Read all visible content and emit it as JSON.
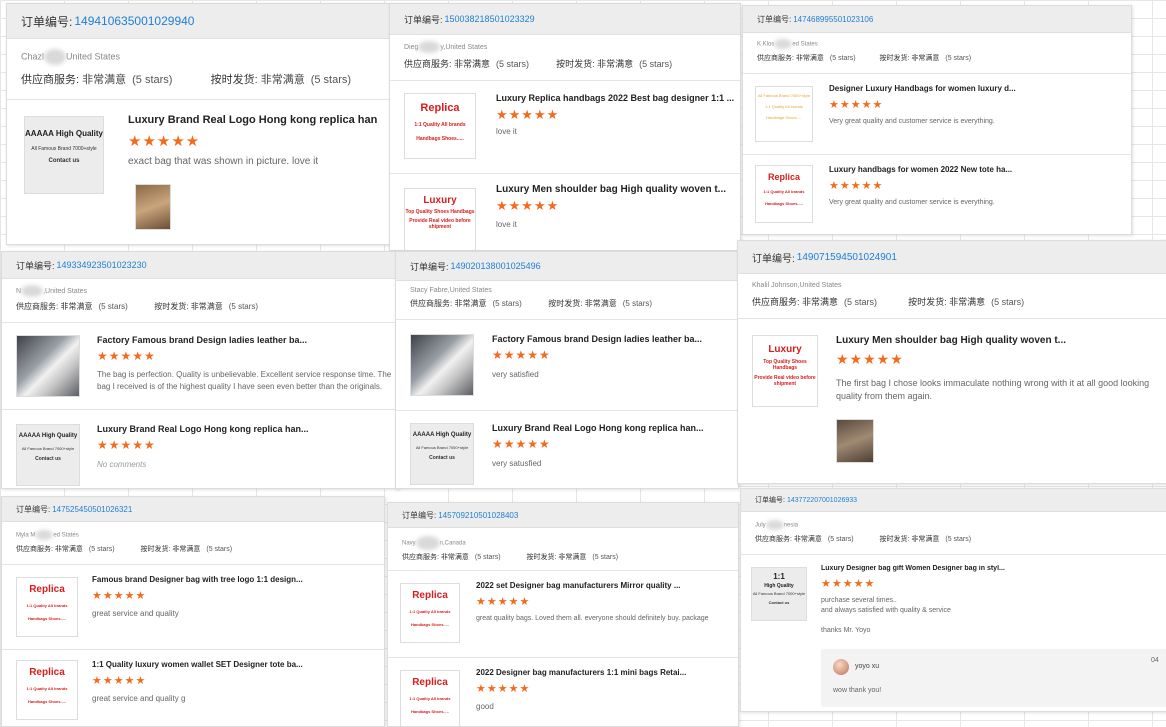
{
  "labels": {
    "order_no": "订单编号:",
    "supplier_service": "供应商服务:",
    "on_time": "按时发货:",
    "very_satisfied": "非常满意",
    "five_stars": "(5 stars)",
    "no_comments": "No comments"
  },
  "cards": [
    {
      "order": "149410635001029940",
      "customer_prefix": "Chazl",
      "customer_suffix": "United States",
      "items": [
        {
          "title": "Luxury Brand Real Logo Hong kong replica han",
          "comment": "exact bag that was shown in picture. love it"
        }
      ]
    },
    {
      "order": "150038218501023329",
      "customer_prefix": "Dieg",
      "customer_suffix": "y,United States",
      "items": [
        {
          "title": "Luxury Replica handbags 2022 Best bag designer 1:1 ...",
          "comment": "love it"
        },
        {
          "title": "Luxury Men shoulder bag High quality woven t...",
          "comment": "love it"
        }
      ]
    },
    {
      "order": "147468995501023106",
      "customer_prefix": "K Klos",
      "customer_suffix": "ed States",
      "items": [
        {
          "title": "Designer Luxury Handbags for women luxury d...",
          "comment": "Very great quality and customer service is everything."
        },
        {
          "title": "Luxury handbags for women 2022 New tote ha...",
          "comment": "Very great quality and customer service is everything."
        }
      ]
    },
    {
      "order": "149334923501023230",
      "customer_prefix": "N",
      "customer_suffix": ",United States",
      "items": [
        {
          "title": "Factory Famous brand Design ladies leather ba...",
          "comment": "The bag is perfection.  Quality is unbelievable.  Excellent service response time. The bag I received is of the highest quality I have seen even better than the originals."
        },
        {
          "title": "Luxury Brand Real Logo Hong kong replica han..."
        }
      ]
    },
    {
      "order": "149020138001025496",
      "customer_prefix": "Stacy Fabre",
      "customer_suffix": ",United States",
      "items": [
        {
          "title": "Factory Famous brand Design ladies leather ba...",
          "comment": "very satisfied"
        },
        {
          "title": "Luxury Brand Real Logo Hong kong replica han...",
          "comment": "very satusfied"
        }
      ]
    },
    {
      "order": "149071594501024901",
      "customer_prefix": "Khalil Johnson",
      "customer_suffix": ",United States",
      "items": [
        {
          "title": "Luxury Men shoulder bag High quality woven t...",
          "comment": "The first bag I chose looks immaculate nothing wrong with it at all good looking quality from them again."
        }
      ]
    },
    {
      "order": "147525450501026321",
      "customer_prefix": "Myla M",
      "customer_suffix": "ed States",
      "items": [
        {
          "title": "Famous brand Designer bag with tree logo 1:1 design...",
          "comment": "great service and quality"
        },
        {
          "title": "1:1 Quality luxury women wallet SET Designer tote ba...",
          "comment": "great service and quality g"
        }
      ]
    },
    {
      "order": "145709210501028403",
      "customer_prefix": "Navy",
      "customer_suffix": "n,Canada",
      "items": [
        {
          "title": "2022 set Designer bag manufacturers Mirror quality ...",
          "comment": "great quality bags. Loved them all. everyone should definitely buy. package"
        },
        {
          "title": "2022 Designer bag manufacturers 1:1 mini bags Retai...",
          "comment": "good"
        }
      ]
    },
    {
      "order": "143772207001026933",
      "customer_prefix": "July",
      "customer_suffix": "nesia",
      "items": [
        {
          "title": "Luxury Designer bag gift Women Designer bag in styl...",
          "comment_lines": [
            "purchase several times..",
            "and always satisfied with quality & service"
          ],
          "extra": "thanks Mr. Yoyo"
        }
      ],
      "reply": {
        "name": "yoyo xu",
        "text": "wow thank you!",
        "date": "04"
      }
    }
  ],
  "thumbs": {
    "aaa": {
      "t1": "AAAAA High Quality",
      "t2": "All Famous Brand 7000+style",
      "t3": "Contact us"
    },
    "replica": {
      "t1": "Replica",
      "t2": "1:1 Quality All brands",
      "t3": "Handbags Shoes....."
    },
    "luxury": {
      "t1": "Luxury",
      "t2": "Top Quality Shoes Handbags",
      "t3": "Provide Real video before shipment"
    },
    "mini": {
      "t1": "1:1",
      "t2": "High Quality",
      "t3": "All Famous Brand 7000+style"
    }
  },
  "stars_text": "★★★★★",
  "colors": {
    "link": "#1e7fd6",
    "star": "#f26b1d",
    "replica_red": "#d91c1c"
  }
}
